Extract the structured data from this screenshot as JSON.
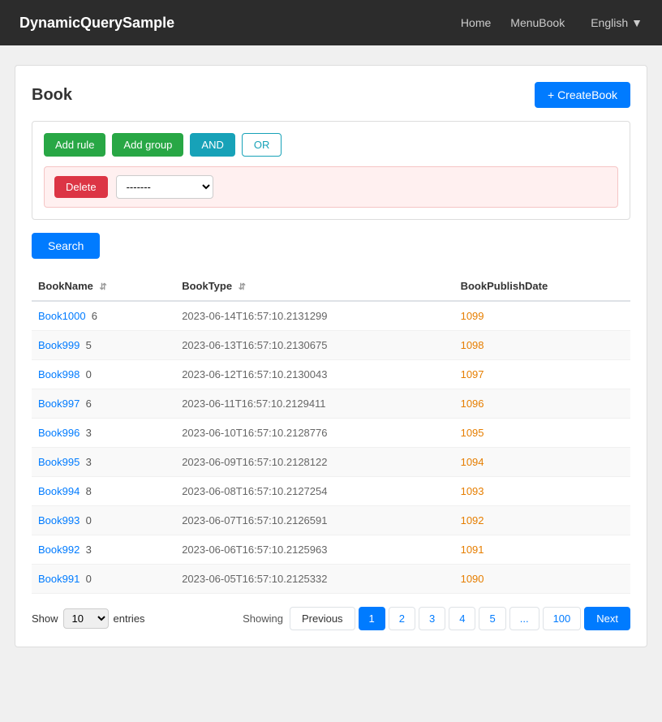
{
  "navbar": {
    "brand": "DynamicQuerySample",
    "links": [
      "Home",
      "MenuBook"
    ],
    "language": "English"
  },
  "page": {
    "title": "Book",
    "create_button": "+ CreateBook"
  },
  "filter": {
    "add_rule_label": "Add rule",
    "add_group_label": "Add group",
    "and_label": "AND",
    "or_label": "OR",
    "delete_label": "Delete",
    "select_placeholder": "-------",
    "select_options": [
      "-------"
    ]
  },
  "search_button": "Search",
  "table": {
    "columns": [
      {
        "label": "BookName",
        "sortable": true
      },
      {
        "label": "BookType",
        "sortable": true
      },
      {
        "label": "BookPublishDate",
        "sortable": false
      }
    ],
    "rows": [
      {
        "name": "Book1000",
        "num": "6",
        "type": "2023-06-14T16:57:10.2131299",
        "id": "1099"
      },
      {
        "name": "Book999",
        "num": "5",
        "type": "2023-06-13T16:57:10.2130675",
        "id": "1098"
      },
      {
        "name": "Book998",
        "num": "0",
        "type": "2023-06-12T16:57:10.2130043",
        "id": "1097"
      },
      {
        "name": "Book997",
        "num": "6",
        "type": "2023-06-11T16:57:10.2129411",
        "id": "1096"
      },
      {
        "name": "Book996",
        "num": "3",
        "type": "2023-06-10T16:57:10.2128776",
        "id": "1095"
      },
      {
        "name": "Book995",
        "num": "3",
        "type": "2023-06-09T16:57:10.2128122",
        "id": "1094"
      },
      {
        "name": "Book994",
        "num": "8",
        "type": "2023-06-08T16:57:10.2127254",
        "id": "1093"
      },
      {
        "name": "Book993",
        "num": "0",
        "type": "2023-06-07T16:57:10.2126591",
        "id": "1092"
      },
      {
        "name": "Book992",
        "num": "3",
        "type": "2023-06-06T16:57:10.2125963",
        "id": "1091"
      },
      {
        "name": "Book991",
        "num": "0",
        "type": "2023-06-05T16:57:10.2125332",
        "id": "1090"
      }
    ]
  },
  "pagination": {
    "show_label": "Show",
    "entries_label": "entries",
    "showing_label": "Showing",
    "entries_value": "10",
    "previous_label": "Previous",
    "next_label": "Next",
    "pages": [
      "1",
      "2",
      "3",
      "4",
      "5",
      "...",
      "100"
    ],
    "active_page": "1"
  }
}
